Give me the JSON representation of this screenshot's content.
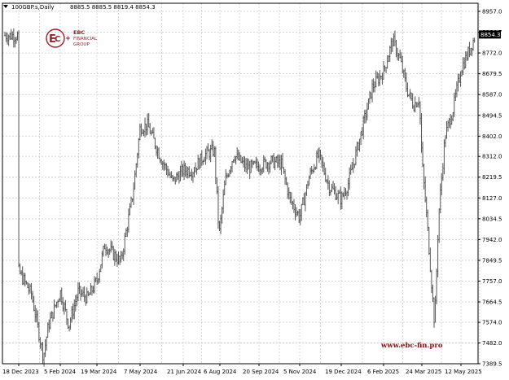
{
  "header": {
    "symbol": "100GBP.s,Daily",
    "ohlc": "8885.5 8885.5 8819.4 8854.3",
    "collapse_icon": "triangle-down-icon"
  },
  "logo": {
    "line1": "EBC",
    "line2": "FINANCIAL",
    "line3": "GROUP",
    "mark": "ebc-monogram-icon"
  },
  "watermark": "www.ebc-fin.pro",
  "colors": {
    "background": "#ffffff",
    "grid": "#d4d4d4",
    "bars": "#555555",
    "logo": "#9a1f2a",
    "price_tag_bg": "#000000",
    "price_tag_text": "#ffffff"
  },
  "chart_data": {
    "type": "ohlc",
    "title": "",
    "price_axis": {
      "ticks": [
        "8957.0",
        "8864.7",
        "8772.0",
        "8679.5",
        "8587.0",
        "8494.5",
        "8402.0",
        "8312.0",
        "8219.5",
        "8127.0",
        "8034.5",
        "7942.0",
        "7849.5",
        "7757.0",
        "7664.5",
        "7574.0",
        "7482.0",
        "7389.5"
      ],
      "ylim": [
        7389.5,
        8957.0
      ],
      "current_price": "8854.3"
    },
    "time_axis": {
      "ticks": [
        "18 Dec 2023",
        "5 Feb 2024",
        "19 Mar 2024",
        "7 May 2024",
        "21 Jun 2024",
        "6 Aug 2024",
        "20 Sep 2024",
        "5 Nov 2024",
        "19 Dec 2024",
        "6 Feb 2025",
        "24 Mar 2025",
        "12 May 2025"
      ]
    },
    "series": [
      {
        "close_path": [
          [
            "18 Dec 2023",
            7800
          ],
          [
            "2 Jan 2024",
            7700
          ],
          [
            "16 Jan 2024",
            7420
          ],
          [
            "22 Jan 2024",
            7560
          ],
          [
            "5 Feb 2024",
            7710
          ],
          [
            "15 Feb 2024",
            7560
          ],
          [
            "26 Feb 2024",
            7710
          ],
          [
            "8 Mar 2024",
            7680
          ],
          [
            "19 Mar 2024",
            7760
          ],
          [
            "28 Mar 2024",
            7920
          ],
          [
            "15 Apr 2024",
            7840
          ],
          [
            "29 Apr 2024",
            8150
          ],
          [
            "7 May 2024",
            8440
          ],
          [
            "15 May 2024",
            8450
          ],
          [
            "29 May 2024",
            8300
          ],
          [
            "10 Jun 2024",
            8200
          ],
          [
            "21 Jun 2024",
            8250
          ],
          [
            "3 Jul 2024",
            8250
          ],
          [
            "18 Jul 2024",
            8320
          ],
          [
            "30 Jul 2024",
            8340
          ],
          [
            "5 Aug 2024",
            7960
          ],
          [
            "12 Aug 2024",
            8200
          ],
          [
            "22 Aug 2024",
            8320
          ],
          [
            "6 Sep 2024",
            8260
          ],
          [
            "20 Sep 2024",
            8270
          ],
          [
            "3 Oct 2024",
            8290
          ],
          [
            "15 Oct 2024",
            8280
          ],
          [
            "25 Oct 2024",
            8120
          ],
          [
            "5 Nov 2024",
            8040
          ],
          [
            "15 Nov 2024",
            8220
          ],
          [
            "25 Nov 2024",
            8320
          ],
          [
            "6 Dec 2024",
            8180
          ],
          [
            "19 Dec 2024",
            8120
          ],
          [
            "27 Dec 2024",
            8190
          ],
          [
            "10 Jan 2025",
            8400
          ],
          [
            "24 Jan 2025",
            8620
          ],
          [
            "6 Feb 2025",
            8690
          ],
          [
            "17 Feb 2025",
            8830
          ],
          [
            "26 Feb 2025",
            8740
          ],
          [
            "6 Mar 2025",
            8610
          ],
          [
            "14 Mar 2025",
            8540
          ],
          [
            "21 Mar 2025",
            8570
          ],
          [
            "24 Mar 2025",
            8300
          ],
          [
            "31 Mar 2025",
            8000
          ],
          [
            "9 Apr 2025",
            7560
          ],
          [
            "14 Apr 2025",
            8050
          ],
          [
            "22 Apr 2025",
            8400
          ],
          [
            "2 May 2025",
            8520
          ],
          [
            "12 May 2025",
            8700
          ],
          [
            "22 May 2025",
            8780
          ],
          [
            "30 May 2025",
            8850
          ]
        ]
      }
    ]
  }
}
